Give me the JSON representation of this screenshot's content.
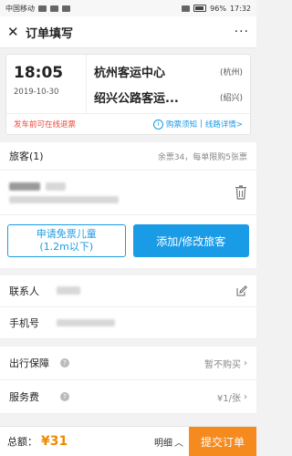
{
  "statusbar": {
    "carrier": "中国移动",
    "battery": "96%",
    "time": "17:32"
  },
  "header": {
    "title": "订单填写",
    "more": "···"
  },
  "trip": {
    "time": "18:05",
    "date": "2019-10-30",
    "from_station": "杭州客运中心",
    "from_city": "(杭州)",
    "to_station": "绍兴公路客运...",
    "to_city": "(绍兴)",
    "refund_text": "发车前可在线退票",
    "notice_link": "购票须知",
    "separator": "|",
    "detail_link": "线路详情>"
  },
  "passenger": {
    "title": "旅客(1)",
    "remain": "余票34，每单限购5张票",
    "child_button_line1": "申请免票儿童",
    "child_button_line2": "(1.2m以下)",
    "add_button": "添加/修改旅客"
  },
  "contact": {
    "label": "联系人"
  },
  "phone": {
    "label": "手机号"
  },
  "guarantee": {
    "label": "出行保障",
    "value": "暂不购买"
  },
  "service": {
    "label": "服务费",
    "value": "¥1/张"
  },
  "bottom": {
    "total_label": "总额：",
    "total": "¥31",
    "detail": "明细",
    "submit": "提交订单"
  }
}
